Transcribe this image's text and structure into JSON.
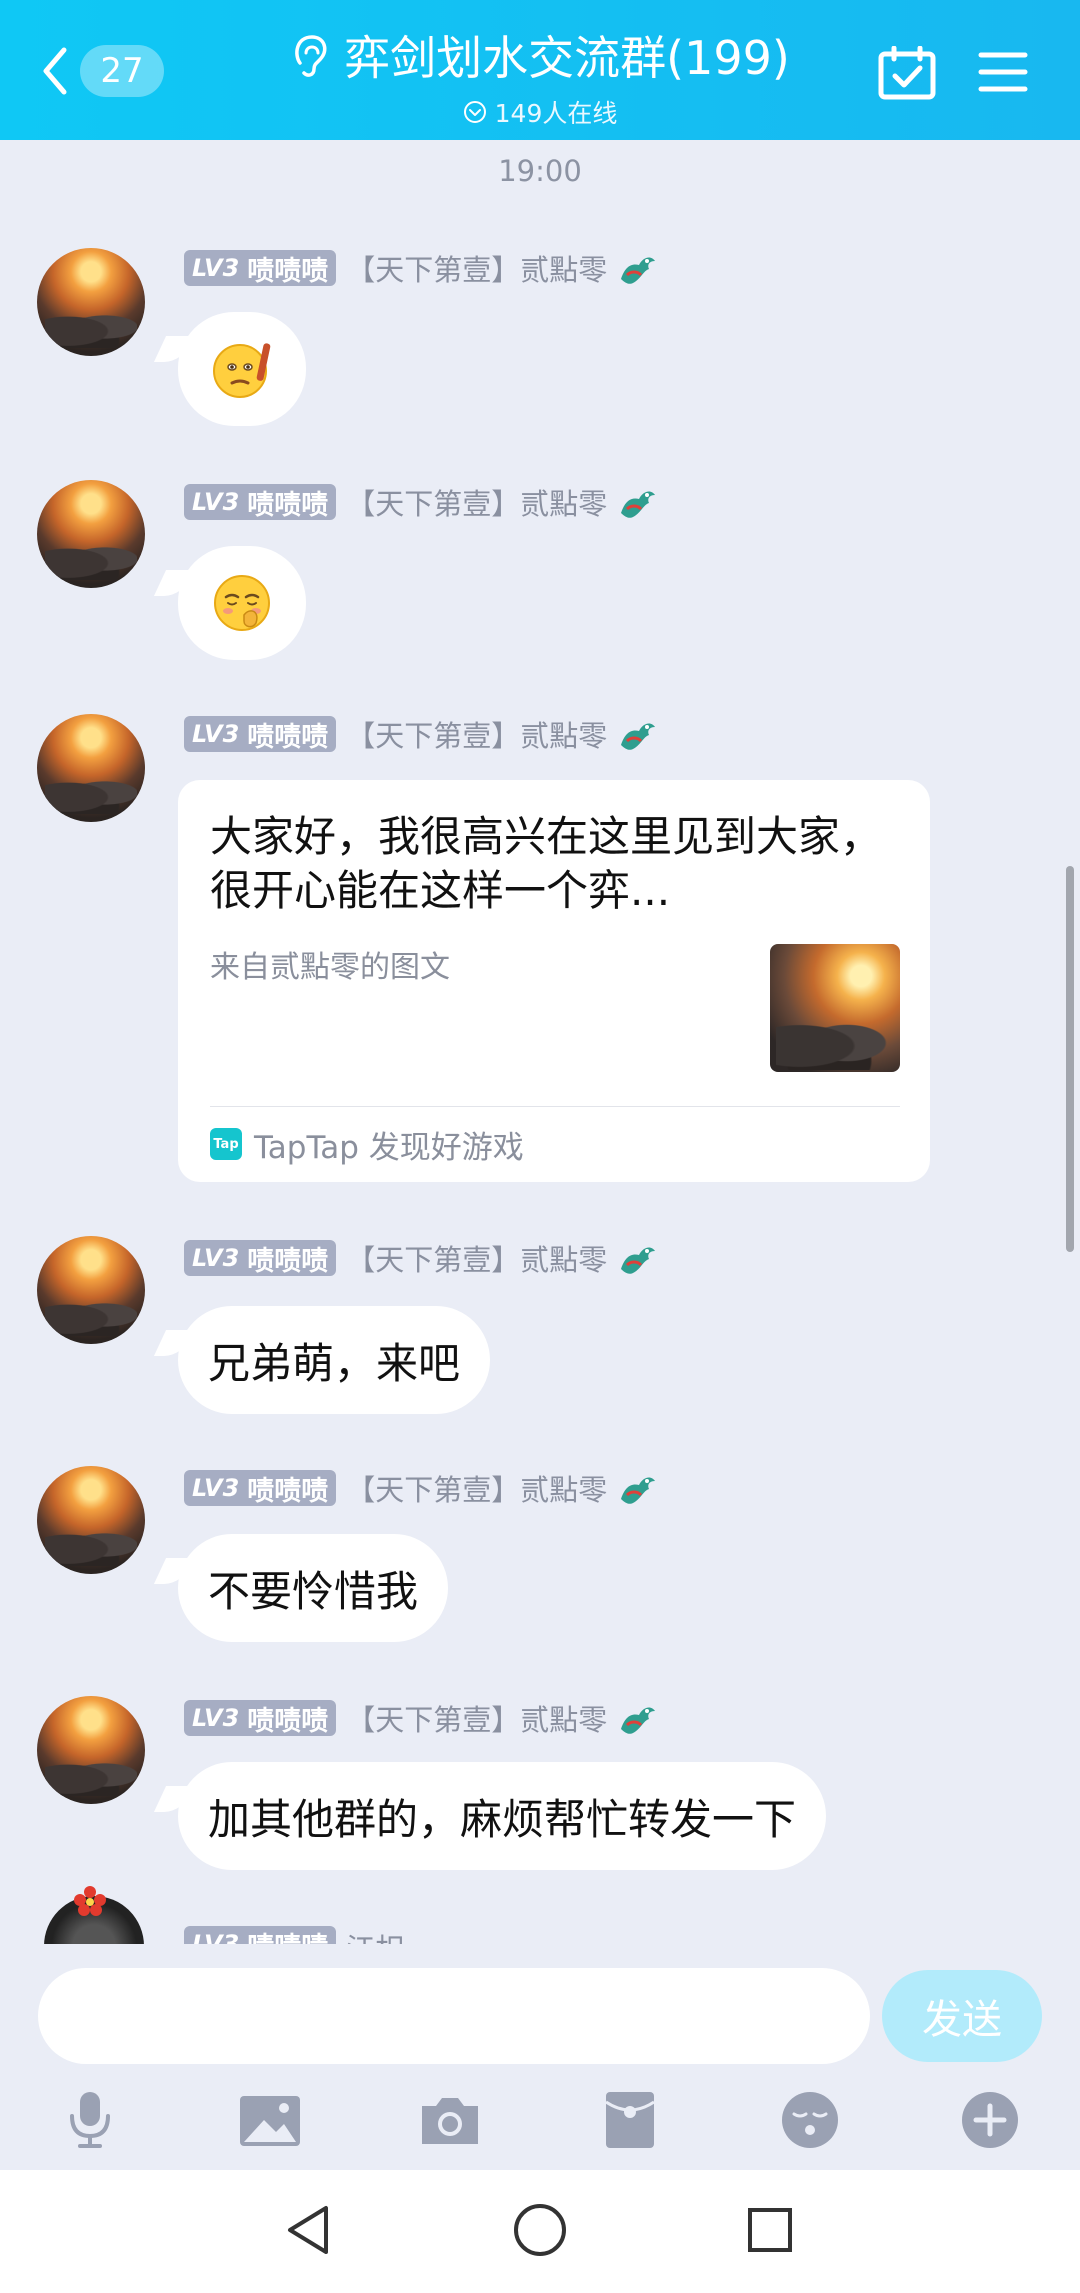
{
  "header": {
    "unread_count": "27",
    "title": "弈剑划水交流群(199)",
    "online_text": "149人在线"
  },
  "time_label": "19:00",
  "sender": {
    "level": "LV3",
    "tag": "啧啧啧",
    "name": "【天下第壹】贰點零"
  },
  "messages": [
    {
      "type": "emoji",
      "emoji": "🫡"
    },
    {
      "type": "emoji",
      "emoji": "🥺"
    },
    {
      "type": "card"
    },
    {
      "type": "text",
      "text": "兄弟萌，来吧"
    },
    {
      "type": "text",
      "text": "不要怜惜我"
    },
    {
      "type": "text",
      "text": "加其他群的，麻烦帮忙转发一下"
    }
  ],
  "card": {
    "text": "大家好，我很高兴在这里见到大家，很开心能在这样一个弈...",
    "source": "来自贰點零的图文",
    "footer_app": "TapTap 发现好游戏",
    "footer_icon_text": "Tap"
  },
  "partial_sender": {
    "level": "LV3",
    "tag": "啧啧啧",
    "name": "江枳"
  },
  "input": {
    "value": "",
    "send_label": "发送"
  },
  "toolbar_icons": [
    "microphone-icon",
    "picture-icon",
    "camera-icon",
    "red-envelope-icon",
    "emoji-icon",
    "plus-icon"
  ],
  "nav_icons": [
    "back-triangle-icon",
    "home-circle-icon",
    "recents-square-icon"
  ]
}
